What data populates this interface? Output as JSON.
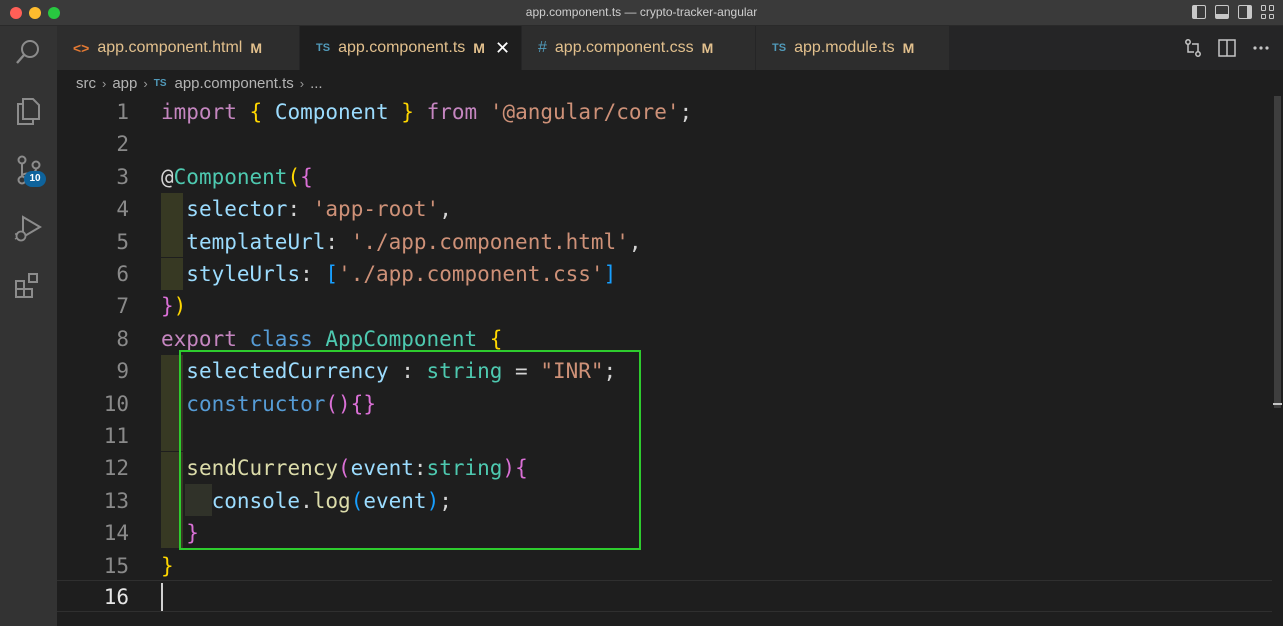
{
  "window": {
    "title": "app.component.ts — crypto-tracker-angular"
  },
  "activity_bar": {
    "scm_badge": "10"
  },
  "tabs": [
    {
      "icon": "<>",
      "label": "app.component.html",
      "status": "M"
    },
    {
      "icon": "TS",
      "label": "app.component.ts",
      "status": "M",
      "close": "✕"
    },
    {
      "icon": "#",
      "label": "app.component.css",
      "status": "M"
    },
    {
      "icon": "TS",
      "label": "app.module.ts",
      "status": "M"
    }
  ],
  "breadcrumbs": {
    "part1": "src",
    "part2": "app",
    "file_icon": "TS",
    "file": "app.component.ts",
    "more": "..."
  },
  "editor": {
    "line_numbers": [
      "1",
      "2",
      "3",
      "4",
      "5",
      "6",
      "7",
      "8",
      "9",
      "10",
      "11",
      "12",
      "13",
      "14",
      "15",
      "16"
    ],
    "tokens": {
      "import": "import",
      "lbrace": "{",
      "component": "Component",
      "rbrace": "}",
      "from": "from",
      "core": "'@angular/core'",
      "semi": ";",
      "at": "@",
      "component_dec": "Component",
      "lparen": "(",
      "selector": "selector",
      "colon": ":",
      "app_root": "'app-root'",
      "comma": ",",
      "templateUrl": "templateUrl",
      "tpl": "'./app.component.html'",
      "styleUrls": "styleUrls",
      "lbracket": "[",
      "css": "'./app.component.css'",
      "rbracket": "]",
      "rparen": ")",
      "export": "export",
      "class": "class",
      "appcomp": "AppComponent",
      "selectedCurrency": "selectedCurrency",
      "spaced_colon": " : ",
      "string": "string",
      "eq": " = ",
      "inr": "\"INR\"",
      "constructor": "constructor",
      "parens": "()",
      "braces": "{}",
      "sendCurrency": "sendCurrency",
      "event": "event",
      "console": "console",
      "dot": ".",
      "log": "log"
    }
  },
  "colors": {
    "keyword": "#c586c0",
    "keyword_blue": "#569cd6",
    "type": "#4ec9b0",
    "string": "#ce9178",
    "property": "#9cdcfe",
    "function": "#dcdcaa",
    "highlight_box": "#2ecc2e"
  }
}
